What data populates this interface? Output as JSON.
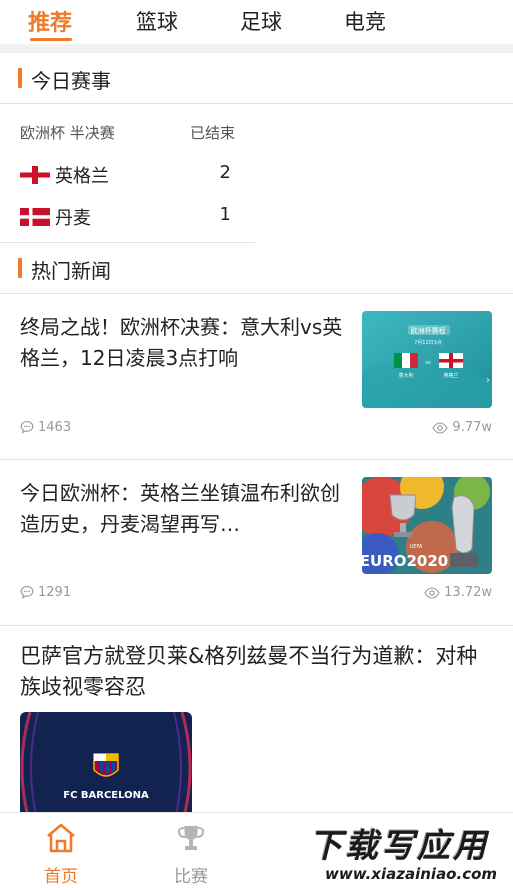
{
  "tabs": [
    {
      "label": "推荐",
      "active": true
    },
    {
      "label": "篮球",
      "active": false
    },
    {
      "label": "足球",
      "active": false
    },
    {
      "label": "电竞",
      "active": false
    }
  ],
  "today": {
    "section_title": "今日赛事",
    "league": "欧洲杯 半决赛",
    "status": "已结束",
    "teams": [
      {
        "name": "英格兰",
        "score": "2",
        "flag": "england-flag"
      },
      {
        "name": "丹麦",
        "score": "1",
        "flag": "denmark-flag"
      }
    ]
  },
  "hot": {
    "section_title": "热门新闻",
    "items": [
      {
        "title": "终局之战！欧洲杯决赛：意大利vs英格兰，12日凌晨3点打响",
        "comments": "1463",
        "views": "9.77w",
        "thumb": {
          "header": "欧洲杯赛程",
          "date": "7月12日3点",
          "left": "意大利",
          "vs": "vs",
          "right": "英格兰"
        }
      },
      {
        "title": "今日欧洲杯：英格兰坐镇温布利欲创造历史，丹麦渴望再写…",
        "comments": "1291",
        "views": "13.72w",
        "thumb": {
          "brand": "EURO2020",
          "small": "UEFA"
        }
      },
      {
        "title": "巴萨官方就登贝莱&格列兹曼不当行为道歉：对种族歧视零容忍",
        "thumb": {
          "brand": "FC BARCELONA"
        }
      }
    ]
  },
  "bottom_nav": [
    {
      "label": "首页",
      "icon": "home-icon",
      "active": true
    },
    {
      "label": "比赛",
      "icon": "trophy-icon",
      "active": false
    }
  ],
  "watermark": {
    "big": "下载写应用",
    "small": "www.xiazainiao.com"
  },
  "colors": {
    "accent": "#f07a2a",
    "muted": "#999999",
    "divider": "#e3e3e3"
  }
}
